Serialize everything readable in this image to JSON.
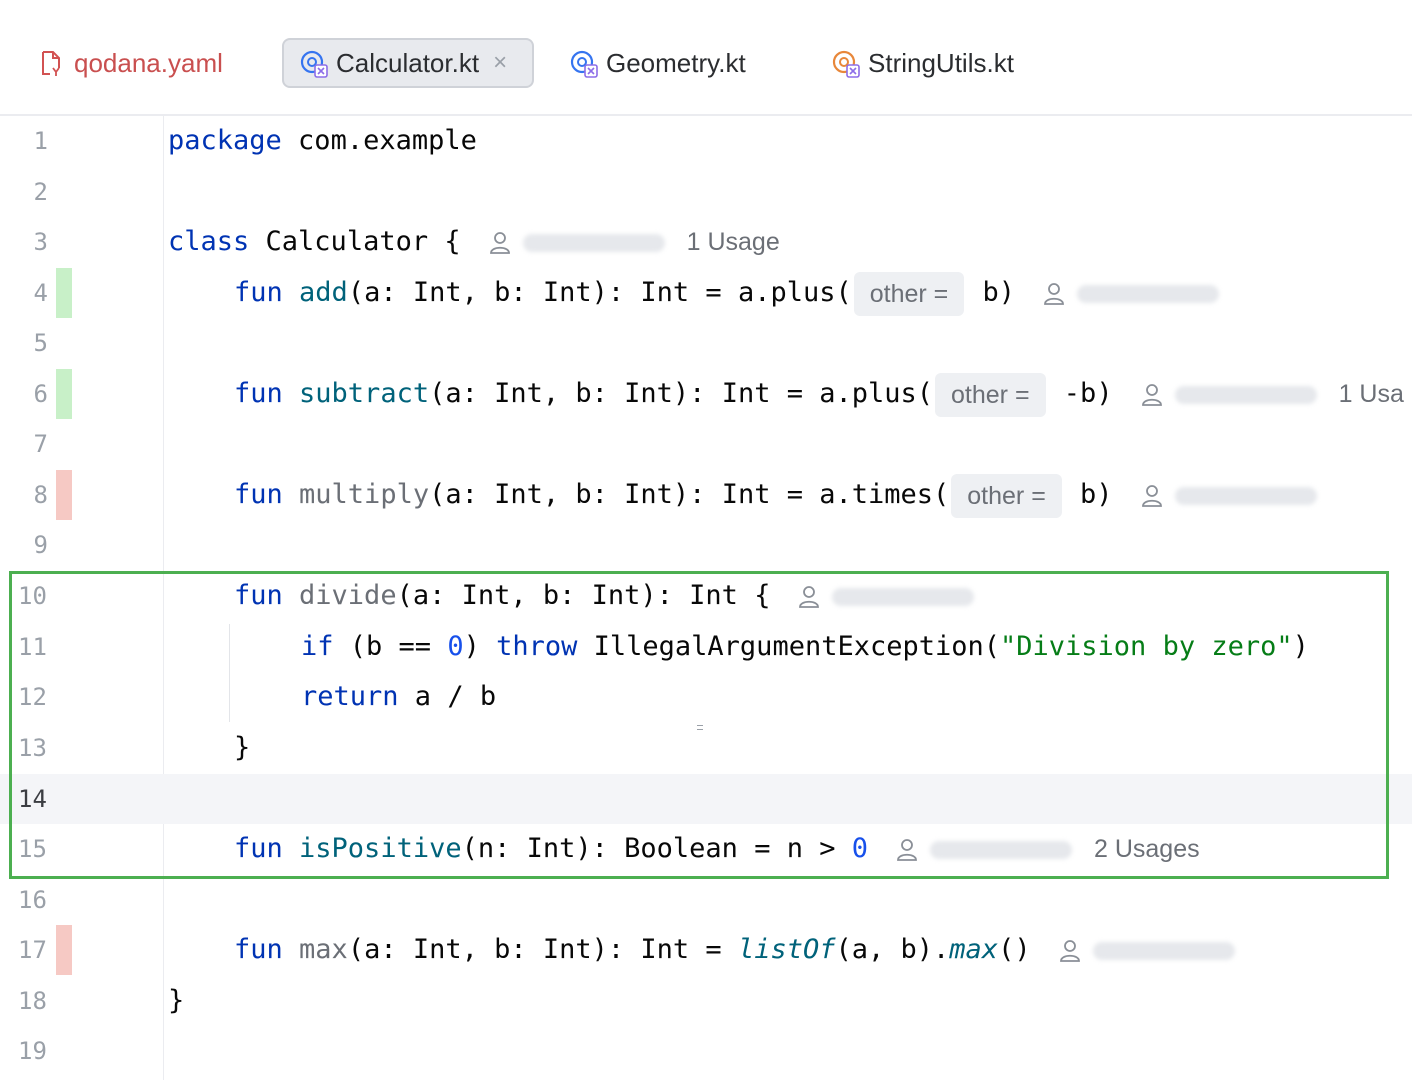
{
  "tabs": [
    {
      "label": "qodana.yaml",
      "icon": "yaml-file-icon",
      "active": false
    },
    {
      "label": "Calculator.kt",
      "icon": "kotlin-class-icon",
      "active": true,
      "close": "×"
    },
    {
      "label": "Geometry.kt",
      "icon": "kotlin-class-icon",
      "active": false
    },
    {
      "label": "StringUtils.kt",
      "icon": "kotlin-class-icon",
      "active": false
    }
  ],
  "colors": {
    "keyword": "#0033b3",
    "function": "#00627a",
    "number": "#1750eb",
    "string": "#067d17",
    "highlight_border": "#4caf50",
    "change_added": "#c8f0c8",
    "change_modified": "#f6c9c4"
  },
  "editor": {
    "line_numbers": [
      "1",
      "2",
      "3",
      "4",
      "5",
      "6",
      "7",
      "8",
      "9",
      "10",
      "11",
      "12",
      "13",
      "14",
      "15",
      "16",
      "17",
      "18",
      "19"
    ],
    "current_line": 14,
    "line1": {
      "kw": "package",
      "rest": " com.example"
    },
    "line3": {
      "kw": "class",
      "rest": " Calculator {",
      "usage": "1 Usage"
    },
    "line4": {
      "kw": "fun",
      "name": " add",
      "sig": "(a: Int, b: Int): Int = a.plus(",
      "hint": "other =",
      "tail": " b)"
    },
    "line6": {
      "kw": "fun",
      "name": " subtract",
      "sig": "(a: Int, b: Int): Int = a.plus(",
      "hint": "other =",
      "tail": " -b)",
      "usage": "1 Usa"
    },
    "line8": {
      "kw": "fun",
      "name": " multiply",
      "sig": "(a: Int, b: Int): Int = a.times(",
      "hint": "other =",
      "tail": " b)"
    },
    "line10": {
      "kw": "fun",
      "name": " divide",
      "sig": "(a: Int, b: Int): Int {"
    },
    "line11": {
      "kw1": "if",
      "p1": " (b == ",
      "num": "0",
      "p2": ") ",
      "kw2": "throw",
      "p3": " IllegalArgumentException(",
      "str": "\"Division by zero\"",
      "p4": ")"
    },
    "line12": {
      "kw": "return",
      "rest": " a / b"
    },
    "line13": {
      "text": "}"
    },
    "line15": {
      "kw": "fun",
      "name": " isPositive",
      "sig": "(n: Int): Boolean = n > ",
      "num": "0",
      "usage": "2 Usages"
    },
    "line17": {
      "kw": "fun",
      "name": " max",
      "sig": "(a: Int, b: Int): Int = ",
      "call1": "listOf",
      "mid": "(a, b).",
      "call2": "max",
      "end": "()"
    },
    "line18": {
      "text": "}"
    }
  }
}
